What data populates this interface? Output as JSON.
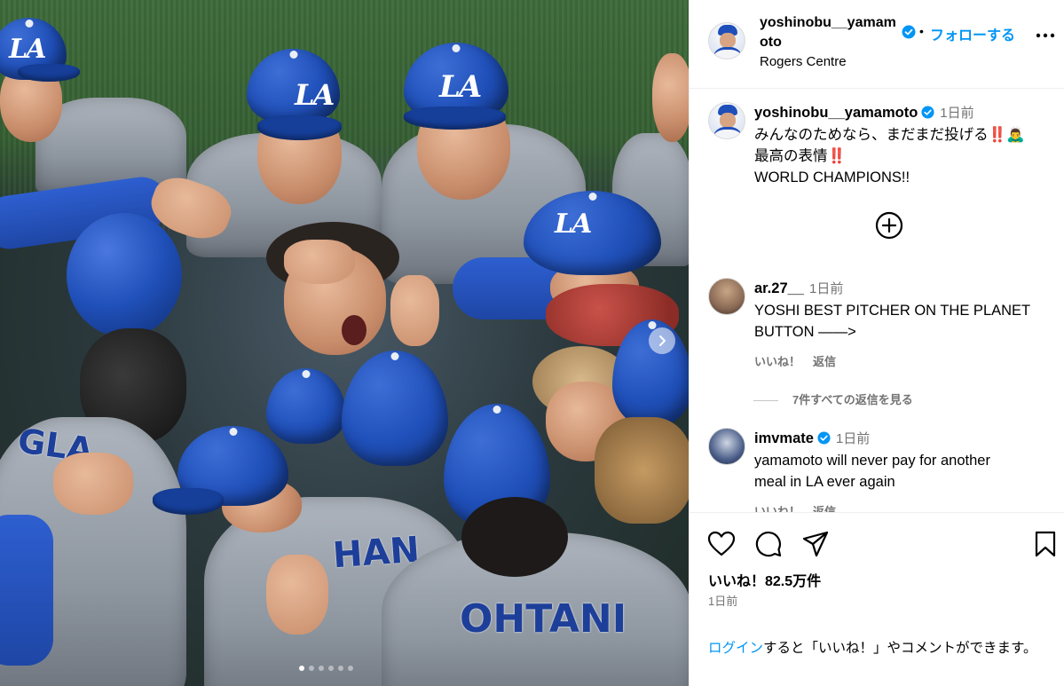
{
  "post": {
    "author": "yoshinobu__yamamoto",
    "follow_label": "フォローする",
    "dot": "•",
    "location": "Rogers Centre"
  },
  "caption": {
    "username": "yoshinobu__yamamoto",
    "time": "1日前",
    "lines": [
      "みんなのためなら、まだまだ投げる‼️🙇‍♂️",
      "最高の表情‼️",
      "WORLD CHAMPIONS!!"
    ]
  },
  "comments": [
    {
      "username": "ar.27__",
      "time": "1日前",
      "lines": [
        "YOSHI BEST PITCHER ON THE PLANET",
        "BUTTON ——>"
      ],
      "like_label": "いいね！",
      "reply_label": "返信"
    },
    {
      "username": "imvmate",
      "time": "1日前",
      "lines": [
        "yamamoto will never pay for another",
        "meal in LA ever again"
      ],
      "like_label": "いいね！",
      "reply_label": "返信"
    }
  ],
  "view_replies_label": "7件すべての返信を見る",
  "actions": {
    "likes_text": "いいね！82.5万件",
    "date_text": "1日前",
    "login_link": "ログイン",
    "login_rest": "すると「いいね！」やコメントができます。"
  },
  "photo": {
    "jersey_names": [
      "GLA",
      "HAN",
      "OHTANI"
    ],
    "logo_text": "LA"
  },
  "colors": {
    "link_blue": "#0095f6",
    "verified_blue": "#0095f6",
    "secondary_text": "#737373",
    "dodger_blue": "#1f4fb8"
  },
  "icons": [
    "verified-badge-icon",
    "more-options-icon",
    "add-circle-icon",
    "heart-icon",
    "comment-icon",
    "share-icon",
    "bookmark-icon",
    "chevron-right-icon"
  ],
  "carousel": {
    "total_slides": 6,
    "current_slide": 1
  }
}
